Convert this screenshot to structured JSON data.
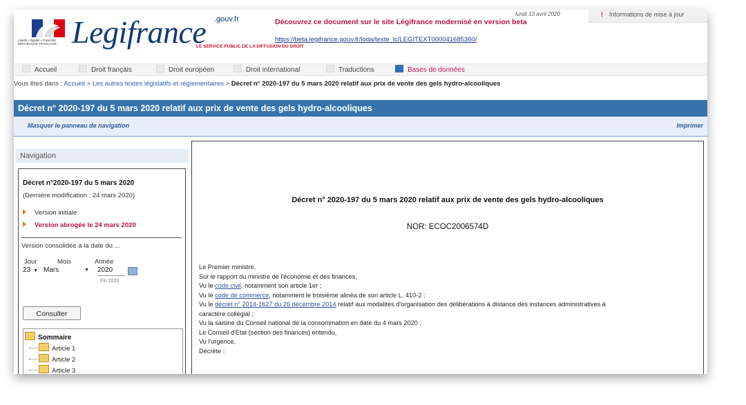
{
  "header": {
    "republic_text": "Liberté • Égalité • Fraternité RÉPUBLIQUE FRANÇAISE",
    "logo": "Legifrance",
    "logo_gouv": ".gouv.fr",
    "logo_sub": "LE SERVICE PUBLIC DE LA DIFFUSION DU DROIT",
    "promo": "Découvrez ce document sur le site Légifrance modernisé en version beta",
    "promo_link": "https://beta.legifrance.gouv.fr/loda/texte_lc/LEGITEXT000041685360/",
    "date": "lundi 13 avril 2020",
    "info": "Informations de mise à jour"
  },
  "menu": [
    "Accueil",
    "Droit français",
    "Droit européen",
    "Droit international",
    "Traductions",
    "Bases de données"
  ],
  "breadcrumb": {
    "prefix": "Vous êtes dans :",
    "home": "Accueil",
    "sep": ">",
    "section": "Les autres textes législatifs et réglementaires",
    "current": "Décret n° 2020-197 du 5 mars 2020 relatif aux prix de vente des gels hydro-alcooliques"
  },
  "title": "Décret n° 2020-197 du 5 mars 2020 relatif aux prix de vente des gels hydro-alcooliques",
  "toolbar": {
    "hide_nav": "Masquer le panneau de navigation",
    "print": "Imprimer"
  },
  "navigation": {
    "heading": "Navigation",
    "decree": "Décret n°2020-197 du 5 mars 2020",
    "last_mod": "(Dernière modification : 24 mars 2020)",
    "version_initial": "Version initiale",
    "version_abrogee": "Version abrogée le 24 mars 2020",
    "consolidated": "Version consolidée à la date du ...",
    "labels": {
      "day": "Jour",
      "month": "Mois",
      "year": "Année"
    },
    "day": "23",
    "month": "Mars",
    "year": "2020",
    "year_min": "Fin 2020",
    "consult": "Consulter",
    "tree_root": "Sommaire",
    "articles": [
      "Article 1",
      "Article 2",
      "Article 3"
    ]
  },
  "document": {
    "title": "Décret n° 2020-197 du 5 mars 2020 relatif aux prix de vente des gels hydro-alcooliques",
    "nor": "NOR: ECOC2006574D",
    "l1": "Le Premier ministre,",
    "l2": "Sur le rapport du ministre de l'économie et des finances,",
    "l3a": "Vu le",
    "l3link": "code civil",
    "l3b": ", notamment son article 1er ;",
    "l4a": "Vu le",
    "l4link": "code de commerce",
    "l4b": ", notamment le troisième alinéa de son article L. 410-2 ;",
    "l5a": "Vu le",
    "l5link": "décret n° 2014-1627 du 26 décembre 2014",
    "l5b": "relatif aux modalités d'organisation des délibérations à distance des instances administratives à",
    "l6": "caractère collégial ;",
    "l7": "Vu la saisine du Conseil national de la consommation en date du 4 mars 2020 ;",
    "l8": "Le Conseil d'Etat (section des finances) entendu,",
    "l9": "Vu l'urgence,",
    "l10": "Décrète :"
  },
  "colors": {
    "title_bar": "#3673ad",
    "accent_red": "#b3134b",
    "link": "#2a5db0"
  }
}
